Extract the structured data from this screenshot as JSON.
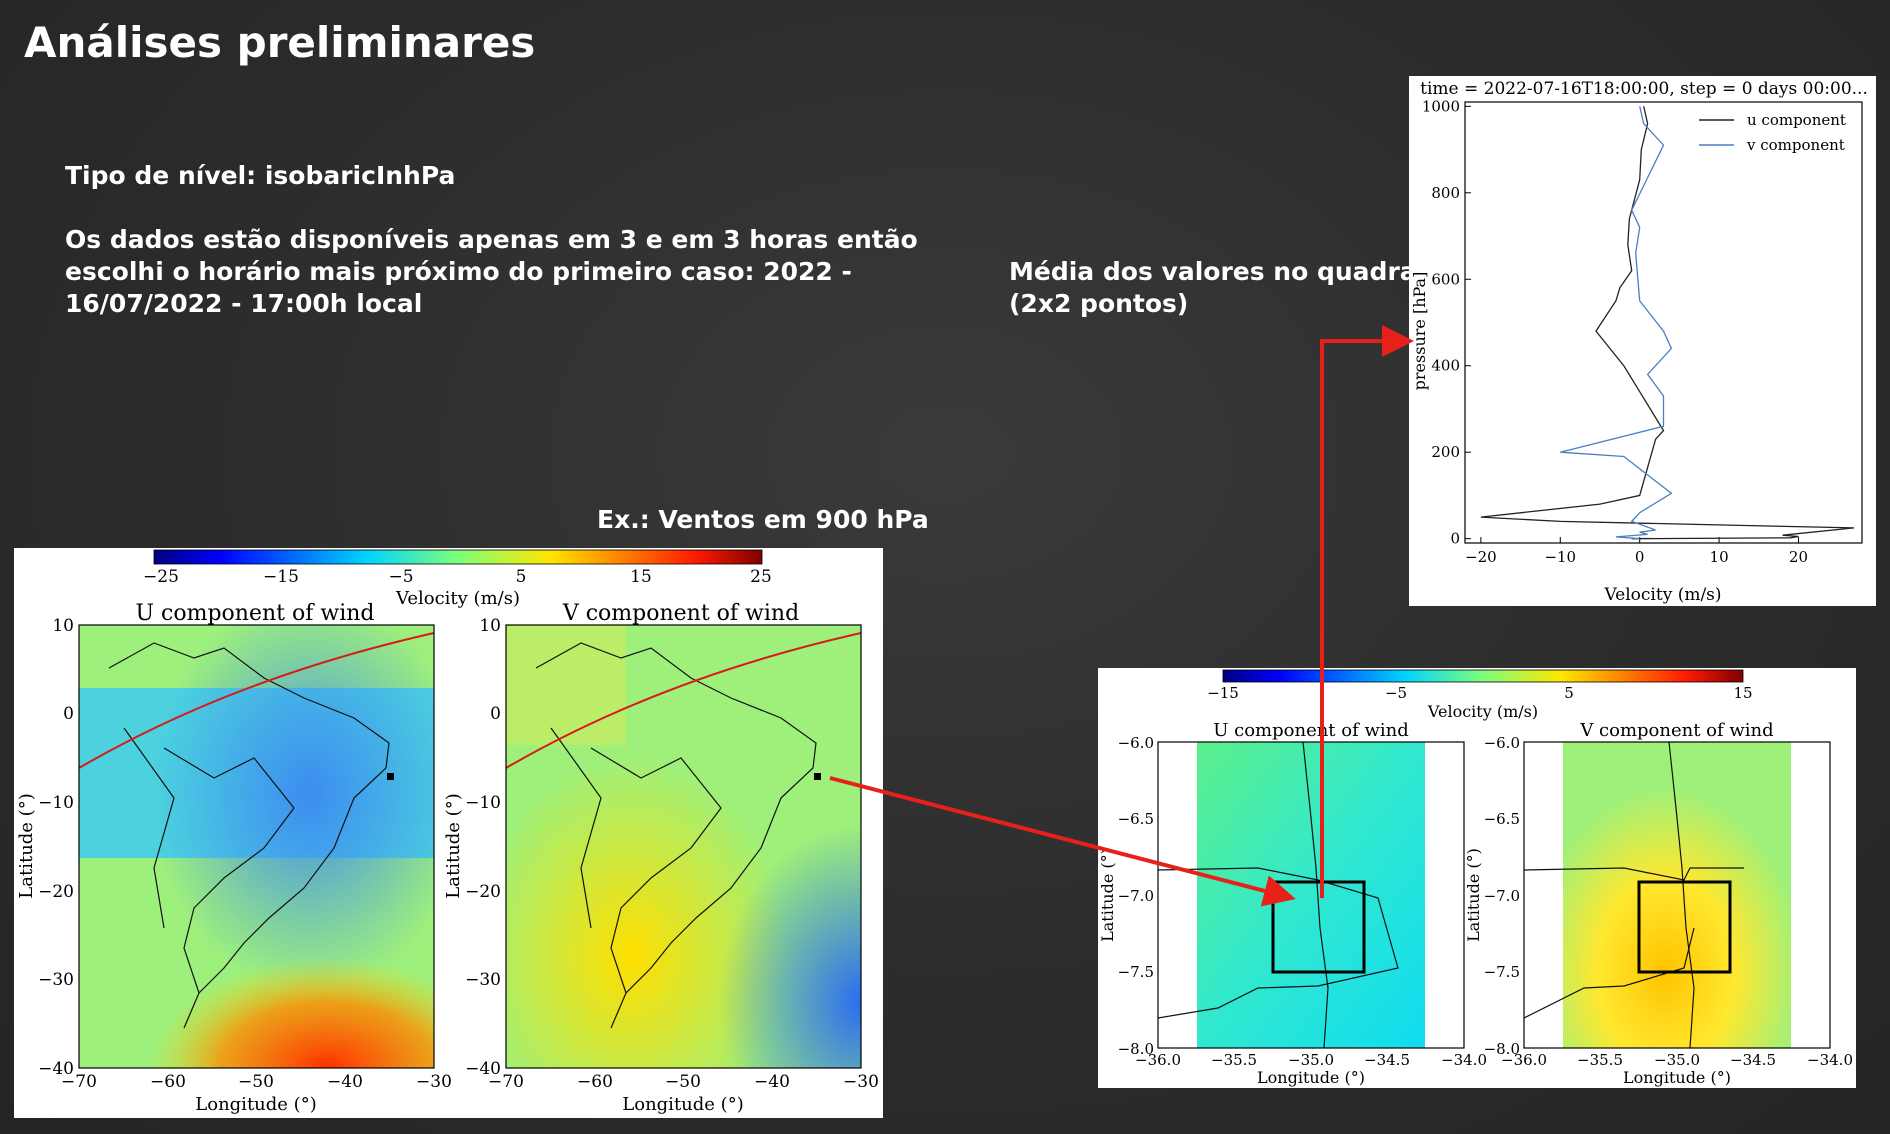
{
  "slide": {
    "title": "Análises preliminares",
    "level_type": "Tipo de nível: isobaricInhPa",
    "availability": [
      "Os dados estão disponíveis apenas em 3 e em 3 horas então",
      "escolhi o horário mais próximo do primeiro caso: 2022 -",
      "16/07/2022 - 17:00h local"
    ],
    "example_label": "Ex.: Ventos em 900 hPa",
    "average_label": [
      "Média dos valores no quadrado",
      "(2x2 pontos)"
    ],
    "arrow_color": "#e8201a"
  },
  "chart_data": [
    {
      "type": "heatmap",
      "panel": "large-maps",
      "colorbar": {
        "label": "Velocity (m/s)",
        "range": [
          -25,
          25
        ],
        "ticks": [
          "−25",
          "−15",
          "−5",
          "5",
          "15",
          "25"
        ]
      },
      "maps": [
        {
          "title": "U component of wind",
          "xlabel": "Longitude (°)",
          "ylabel": "Latitude (°)",
          "xlim": [
            -70,
            -30
          ],
          "ylim": [
            -40,
            10
          ],
          "xticks": [
            "−70",
            "−60",
            "−50",
            "−40",
            "−30"
          ],
          "yticks": [
            "−40",
            "−30",
            "−20",
            "−10",
            "0",
            "10"
          ]
        },
        {
          "title": "V component of wind",
          "xlabel": "Longitude (°)",
          "ylabel": "Latitude (°)",
          "xlim": [
            -70,
            -30
          ],
          "ylim": [
            -40,
            10
          ],
          "xticks": [
            "−70",
            "−60",
            "−50",
            "−40",
            "−30"
          ],
          "yticks": [
            "−40",
            "−30",
            "−20",
            "−10",
            "0",
            "10"
          ]
        }
      ]
    },
    {
      "type": "heatmap",
      "panel": "zoom-maps",
      "colorbar": {
        "label": "Velocity (m/s)",
        "range": [
          -15,
          15
        ],
        "ticks": [
          "−15",
          "−5",
          "5",
          "15"
        ]
      },
      "maps": [
        {
          "title": "U component of wind",
          "xlabel": "Longitude (°)",
          "ylabel": "Latitude (°)",
          "xlim": [
            -36,
            -34
          ],
          "ylim": [
            -8,
            -6
          ],
          "xticks": [
            "−36.0",
            "−35.5",
            "−35.0",
            "−34.5",
            "−34.0"
          ],
          "yticks": [
            "−8.0",
            "−7.5",
            "−7.0",
            "−6.5",
            "−6.0"
          ]
        },
        {
          "title": "V component of wind",
          "xlabel": "Longitude (°)",
          "ylabel": "Latitude (°)",
          "xlim": [
            -36,
            -34
          ],
          "ylim": [
            -8,
            -6
          ],
          "xticks": [
            "−36.0",
            "−35.5",
            "−35.0",
            "−34.5",
            "−34.0"
          ],
          "yticks": [
            "−8.0",
            "−7.5",
            "−7.0",
            "−6.5",
            "−6.0"
          ]
        }
      ]
    },
    {
      "type": "line",
      "panel": "profile",
      "title": "time = 2022-07-16T18:00:00, step = 0 days 00:00...",
      "xlabel": "Velocity (m/s)",
      "ylabel": "pressure [hPa]",
      "xlim": [
        -22,
        28
      ],
      "ylim": [
        -10,
        1010
      ],
      "xticks": [
        -20,
        -10,
        0,
        10,
        20
      ],
      "yticks": [
        0,
        200,
        400,
        600,
        800,
        1000
      ],
      "legend_position": "top-right",
      "series": [
        {
          "name": "u component",
          "color": "#222222",
          "x": [
            0.5,
            1,
            0.2,
            0,
            -1.3,
            -1.5,
            -1,
            -2.5,
            -3,
            -5.5,
            -2,
            0,
            3,
            2,
            0,
            -5,
            -20,
            -10,
            27,
            18,
            20,
            19,
            -1
          ],
          "y": [
            1000,
            960,
            900,
            830,
            740,
            680,
            620,
            580,
            550,
            480,
            400,
            340,
            250,
            230,
            100,
            80,
            50,
            40,
            25,
            8,
            5,
            2,
            0
          ]
        },
        {
          "name": "v component",
          "color": "#4a7fc0",
          "x": [
            0,
            0.5,
            3,
            -1,
            0,
            -0.5,
            0,
            3,
            4,
            1,
            3,
            3,
            -10,
            -2,
            4,
            0,
            -1,
            2,
            0,
            1,
            -3,
            0
          ],
          "y": [
            1000,
            960,
            910,
            760,
            720,
            660,
            550,
            480,
            440,
            380,
            330,
            260,
            200,
            190,
            105,
            60,
            40,
            20,
            15,
            10,
            4,
            0
          ]
        }
      ]
    }
  ]
}
